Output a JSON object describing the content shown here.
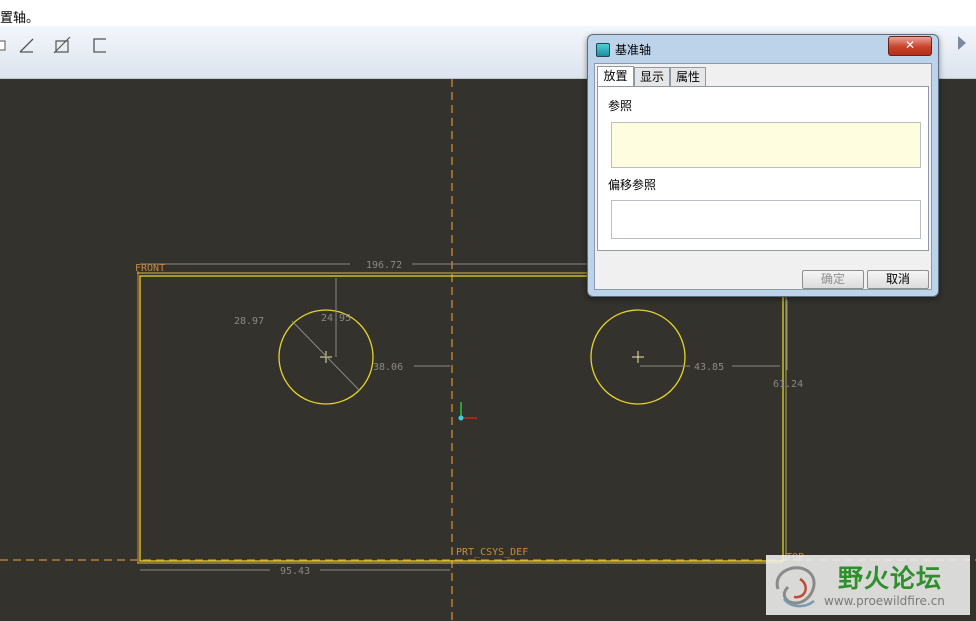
{
  "message_bar": {
    "text": "置轴。"
  },
  "dialog": {
    "title": "基准轴",
    "close_label": "✕",
    "tabs": [
      {
        "label": "放置",
        "active": true
      },
      {
        "label": "显示",
        "active": false
      },
      {
        "label": "属性",
        "active": false
      }
    ],
    "references_label": "参照",
    "references_value": "",
    "offset_references_label": "偏移参照",
    "offset_references_value": "",
    "ok_label": "确定",
    "cancel_label": "取消"
  },
  "sketch": {
    "datum_front": "FRONT",
    "datum_top": "TOP",
    "csys_label": "PRT_CSYS_DEF",
    "dim_width": "196.72",
    "dim_left_width": "95.43",
    "dim_hole1_diameter": "28.97",
    "dim_hole1_vertical": "24.95",
    "dim_hole1_horizontal": "38.06",
    "dim_hole2_horizontal": "43.85",
    "dim_right": "61.24"
  },
  "watermark": {
    "title": "野火论坛",
    "url": "www.proewildfire.cn"
  },
  "colors": {
    "background": "#33322d",
    "sketch_yellow": "#e6d22a",
    "datum_orange": "#d08a33",
    "dimension_gray": "#8a8a82",
    "reference_field": "#fffde0"
  }
}
